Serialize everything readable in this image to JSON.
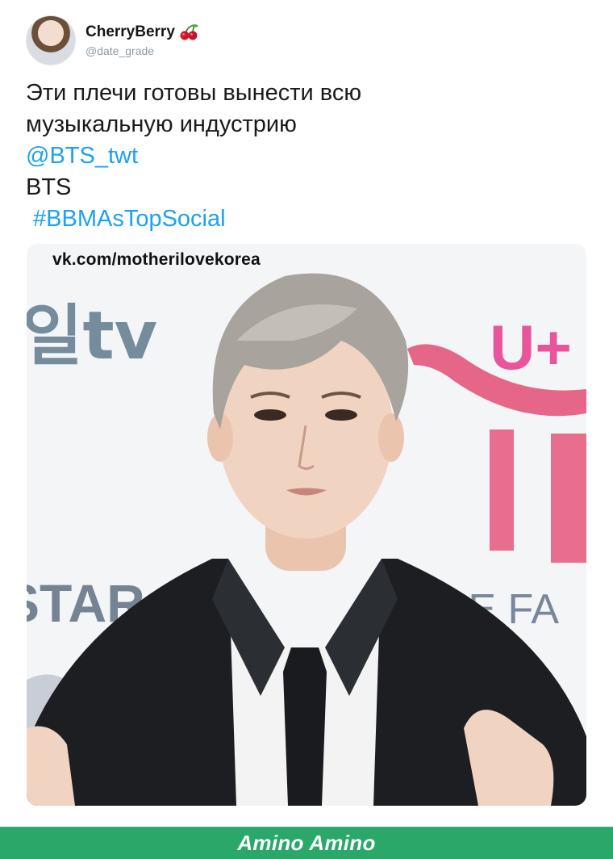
{
  "tweet": {
    "display_name": "CherryBerry",
    "handle": "@date_grade",
    "text_line_1": "Эти плечи готовы вынести всю",
    "text_line_2": "музыкальную индустрию",
    "mention": "@BTS_twt",
    "text_line_4": "BTS",
    "hashtag": "#BBMAsTopSocial"
  },
  "media": {
    "watermark": "vk.com/motherilovekorea",
    "backdrop_text_left": "일tv",
    "backdrop_text_star": "STAR",
    "backdrop_text_right_top": "U+",
    "backdrop_text_right_bottom": "THE FA"
  },
  "footer": {
    "label": "Amino Amino"
  },
  "colors": {
    "link": "#1da1f2",
    "footer_bg": "#2aa86a",
    "accent_pink": "#e4567a"
  }
}
